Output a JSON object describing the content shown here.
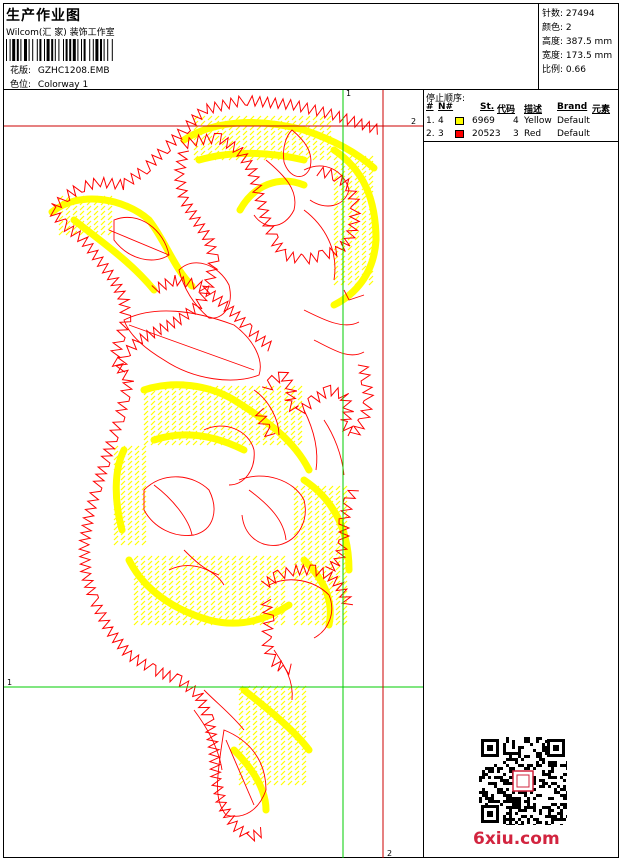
{
  "header": {
    "title": "生产作业图",
    "company": "Wilcom(汇 家) 装饰工作室",
    "design_label": "花版:",
    "design_value": "GZHC1208.EMB",
    "color_label": "色位:",
    "color_value": "Colorway 1"
  },
  "stats": {
    "stitches_label": "针数:",
    "stitches_value": "27494",
    "colors_label": "颜色:",
    "colors_value": "2",
    "height_label": "高度:",
    "height_value": "387.5 mm",
    "width_label": "宽度:",
    "width_value": "173.5 mm",
    "scale_label": "比例:",
    "scale_value": "0.66"
  },
  "stop_sequence": {
    "title": "停止顺序:",
    "columns": [
      "#",
      "N#",
      "St.",
      "代码",
      "描述",
      "Brand",
      "元素"
    ],
    "rows": [
      {
        "idx": "1.",
        "n": "4",
        "color_hex": "#ffff00",
        "code": "6969",
        "st": "4",
        "desc": "Yellow",
        "brand": "Default"
      },
      {
        "idx": "2.",
        "n": "3",
        "color_hex": "#ff0000",
        "code": "20523",
        "st": "3",
        "desc": "Red",
        "brand": "Default"
      }
    ]
  },
  "guides": {
    "h1_label": "1",
    "h2_label": "2",
    "v1_label": "1",
    "v2_label": "2",
    "color_green": "#00cc00",
    "color_red": "#cc0000"
  },
  "watermark": {
    "site": "6xiu.com"
  },
  "colors": {
    "yellow": "#ffff00",
    "red": "#ff0000",
    "accent": "#d2243f"
  }
}
